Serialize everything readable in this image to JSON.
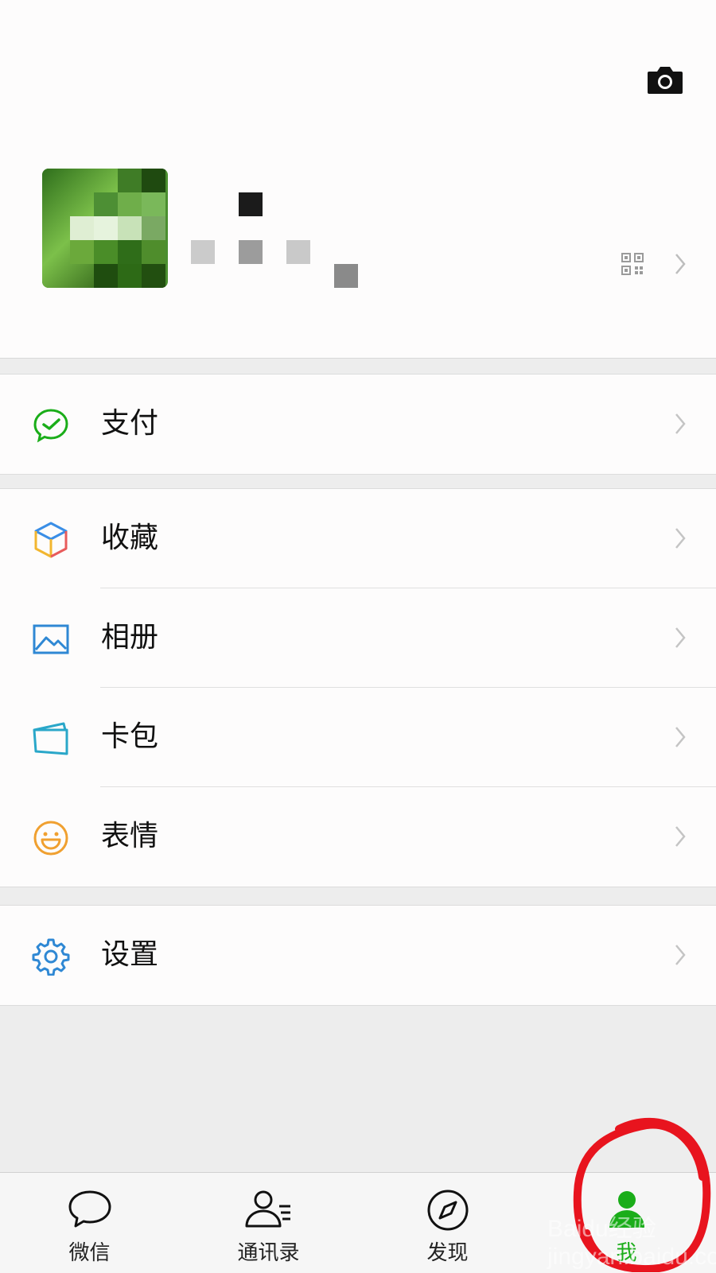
{
  "header": {
    "camera_icon": "camera-icon",
    "qr_icon": "qr-code-icon"
  },
  "menu_groups": [
    {
      "items": [
        {
          "label": "支付",
          "icon": "wechat-pay-icon"
        }
      ]
    },
    {
      "items": [
        {
          "label": "收藏",
          "icon": "favorites-cube-icon"
        },
        {
          "label": "相册",
          "icon": "album-icon"
        },
        {
          "label": "卡包",
          "icon": "card-wallet-icon"
        },
        {
          "label": "表情",
          "icon": "sticker-smile-icon"
        }
      ]
    },
    {
      "items": [
        {
          "label": "设置",
          "icon": "settings-gear-icon"
        }
      ]
    }
  ],
  "tabbar": {
    "tabs": [
      {
        "label": "微信",
        "icon": "chat-bubble-icon",
        "active": false
      },
      {
        "label": "通讯录",
        "icon": "contacts-icon",
        "active": false
      },
      {
        "label": "发现",
        "icon": "compass-icon",
        "active": false
      },
      {
        "label": "我",
        "icon": "me-icon",
        "active": true
      }
    ]
  },
  "colors": {
    "accent_green": "#1aad19",
    "annotation_red": "#e8141e"
  },
  "watermark": "Baidu经验 jingyan.baidu.com"
}
